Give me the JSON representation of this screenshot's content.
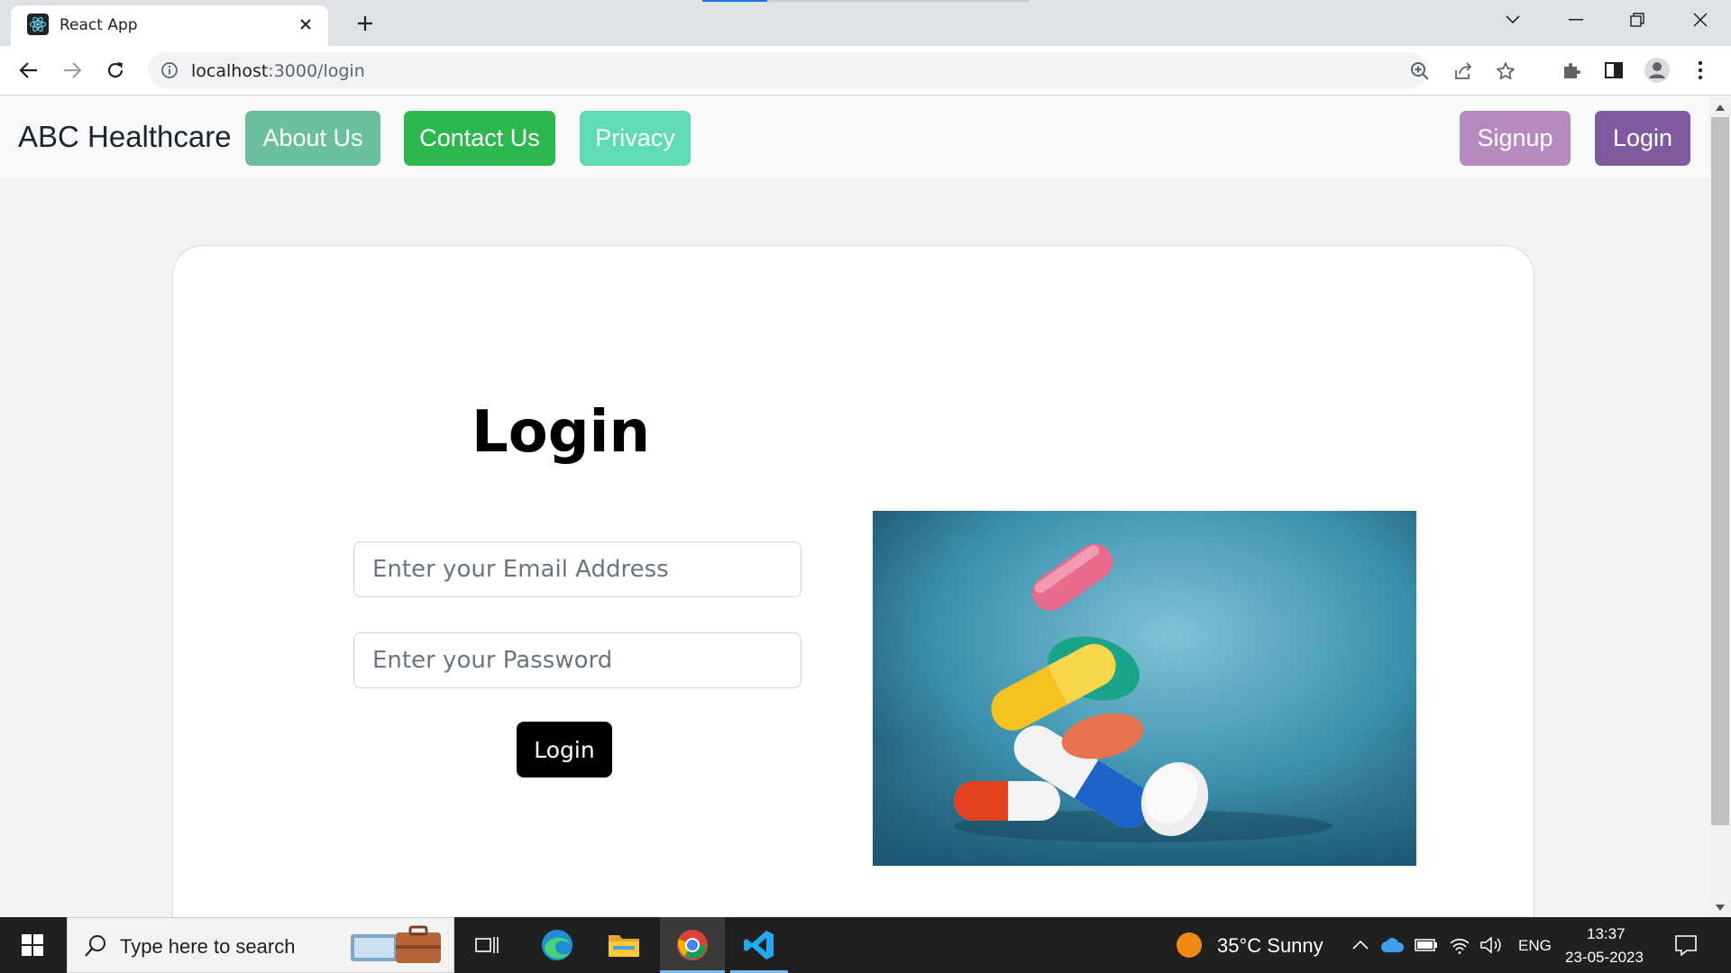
{
  "browser": {
    "tab_title": "React App",
    "url_host": "localhost",
    "url_path": ":3000/login"
  },
  "navbar": {
    "brand": "ABC Healthcare",
    "about": "About Us",
    "contact": "Contact Us",
    "privacy": "Privacy",
    "signup": "Signup",
    "login": "Login"
  },
  "colors": {
    "about": "#6abf9d",
    "contact": "#2cb74f",
    "privacy": "#5fdbb5",
    "signup": "#b58bbf",
    "login": "#7f5a9e"
  },
  "login_form": {
    "title": "Login",
    "email_placeholder": "Enter your Email Address",
    "password_placeholder": "Enter your Password",
    "submit": "Login"
  },
  "taskbar": {
    "search_placeholder": "Type here to search",
    "weather": "35°C  Sunny",
    "language": "ENG",
    "time": "13:37",
    "date": "23-05-2023"
  }
}
